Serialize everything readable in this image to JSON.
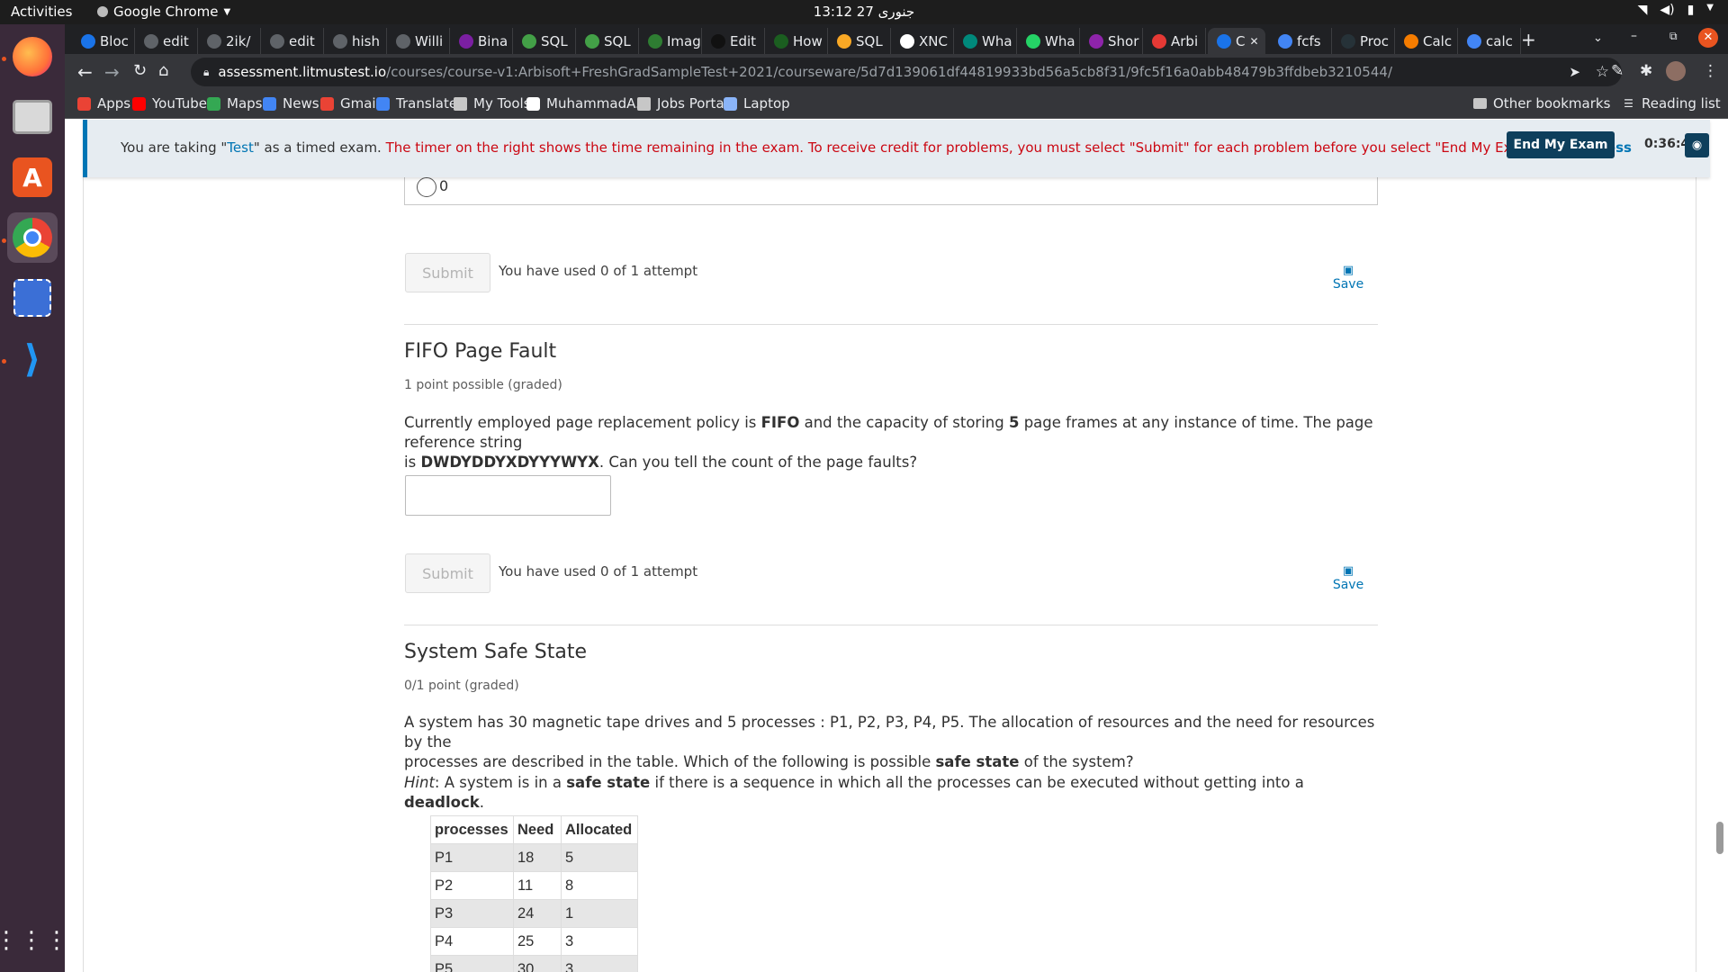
{
  "os": {
    "activities": "Activities",
    "app_name": "Google Chrome",
    "clock": "13:12 جنوری 27"
  },
  "tabs": [
    {
      "label": "Bloc",
      "color": "#1a73e8"
    },
    {
      "label": "edit",
      "color": "#5f6368"
    },
    {
      "label": "2ik/",
      "color": "#5f6368"
    },
    {
      "label": "edit",
      "color": "#5f6368"
    },
    {
      "label": "hish",
      "color": "#5f6368"
    },
    {
      "label": "Willi",
      "color": "#5f6368"
    },
    {
      "label": "Bina",
      "color": "#7b1fa2"
    },
    {
      "label": "SQL",
      "color": "#43a047"
    },
    {
      "label": "SQL",
      "color": "#43a047"
    },
    {
      "label": "Imag",
      "color": "#2e7d32"
    },
    {
      "label": "Edit",
      "color": "#111111"
    },
    {
      "label": "How",
      "color": "#1b5e20"
    },
    {
      "label": "SQL",
      "color": "#f9a825"
    },
    {
      "label": "XNC",
      "color": "#ffffff"
    },
    {
      "label": "Wha",
      "color": "#00897b"
    },
    {
      "label": "Wha",
      "color": "#25d366"
    },
    {
      "label": "Shor",
      "color": "#8e24aa"
    },
    {
      "label": "Arbi",
      "color": "#e53935"
    },
    {
      "label": "C",
      "color": "#1a73e8"
    },
    {
      "label": "fcfs",
      "color": "#4285f4"
    },
    {
      "label": "Proc",
      "color": "#263238"
    },
    {
      "label": "Calc",
      "color": "#f57c00"
    },
    {
      "label": "calc",
      "color": "#4285f4"
    }
  ],
  "omnibox": {
    "host": "assessment.litmustest.io",
    "path": "/courses/course-v1:Arbisoft+FreshGradSampleTest+2021/courseware/5d7d139061df44819933bd56a5cb8f31/9fc5f16a0abb48479b3ffdbeb3210544/"
  },
  "bookmarks": [
    {
      "label": "Apps",
      "icon": "apps-grid-icon",
      "color": "#ea4335"
    },
    {
      "label": "YouTube",
      "icon": "youtube-icon",
      "color": "#ff0000"
    },
    {
      "label": "Maps",
      "icon": "maps-pin-icon",
      "color": "#34a853"
    },
    {
      "label": "News",
      "icon": "news-icon",
      "color": "#4285f4"
    },
    {
      "label": "Gmail",
      "icon": "gmail-icon",
      "color": "#ea4335"
    },
    {
      "label": "Translate",
      "icon": "translate-icon",
      "color": "#4285f4"
    },
    {
      "label": "My Tools",
      "icon": "folder-icon",
      "color": "#c7c7c7"
    },
    {
      "label": "MuhammadA...",
      "icon": "github-icon",
      "color": "#ffffff"
    },
    {
      "label": "Jobs Portal",
      "icon": "folder-icon",
      "color": "#c7c7c7"
    },
    {
      "label": "Laptop",
      "icon": "globe-icon",
      "color": "#8ab4f8"
    }
  ],
  "bookmarks_right": {
    "other": "Other bookmarks",
    "reading": "Reading list"
  },
  "banner": {
    "part1": "You are taking \"",
    "test_word": "Test",
    "part2": "\" as a timed exam. ",
    "warn": "The timer on the right shows the time remaining in the exam. To receive credit for problems, you must select \"Submit\" for each problem before you select \"End My Exam\".",
    "show_less": "Show Less",
    "end_exam": "End My Exam",
    "timer": "0:36:48"
  },
  "prev_problem": {
    "option_label": "0",
    "submit": "Submit",
    "attempts": "You have used 0 of 1 attempt",
    "save": "Save"
  },
  "fifo": {
    "title": "FIFO Page Fault",
    "meta": "1 point possible (graded)",
    "t1": "Currently employed page replacement policy is ",
    "b1": "FIFO",
    "t2": " and the capacity of storing ",
    "b2": "5",
    "t3": " page frames at any instance of time. The page reference string",
    "t4": "is ",
    "b3": "DWDYDDYXDYYYWYX",
    "t5": ". Can you tell the count of the page faults?",
    "answer_value": "",
    "submit": "Submit",
    "attempts": "You have used 0 of 1 attempt",
    "save": "Save"
  },
  "safe": {
    "title": "System Safe State",
    "meta": "0/1 point (graded)",
    "line1": "A system has 30 magnetic tape drives and 5 processes : P1, P2, P3, P4, P5. The allocation of resources and the need for resources by the",
    "line2a": "processes are described in the table. Which of the following is possible ",
    "line2b": "safe state",
    "line2c": " of the system?",
    "hint_i": "Hint",
    "hint1": ": A system is in a ",
    "hint_b1": "safe state",
    "hint2": " if there is a sequence in which all the processes can be executed without getting into a ",
    "hint_b2": "deadlock",
    "hint3": ".",
    "table": {
      "headers": [
        "processes",
        "Need",
        "Allocated"
      ],
      "rows": [
        [
          "P1",
          "18",
          "5"
        ],
        [
          "P2",
          "11",
          "8"
        ],
        [
          "P3",
          "24",
          "1"
        ],
        [
          "P4",
          "25",
          "3"
        ],
        [
          "P5",
          "30",
          "3"
        ]
      ]
    }
  }
}
